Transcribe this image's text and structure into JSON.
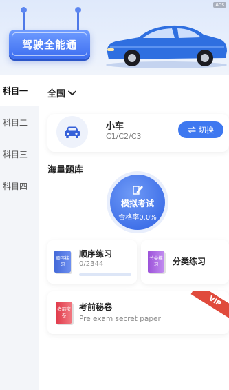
{
  "banner": {
    "ad_tag": "Ads",
    "sign_text": "驾驶全能通"
  },
  "sidebar": {
    "items": [
      {
        "label": "科目一",
        "active": true
      },
      {
        "label": "科目二",
        "active": false
      },
      {
        "label": "科目三",
        "active": false
      },
      {
        "label": "科目四",
        "active": false
      }
    ]
  },
  "region": {
    "label": "全国"
  },
  "vehicle": {
    "title": "小车",
    "subtitle": "C1/C2/C3",
    "switch_label": "切换"
  },
  "question_bank": {
    "title": "海量题库",
    "mock_exam": {
      "label": "模拟考试",
      "pass_rate": "合格率0.0%"
    },
    "sequential": {
      "cover": "顺序练习",
      "title": "顺序练习",
      "progress": "0/2344",
      "progress_value": 0
    },
    "category": {
      "cover": "分类练习",
      "title": "分类练习"
    },
    "pre_exam": {
      "cover": "考前密卷",
      "title": "考前秘卷",
      "subtitle": "Pre exam secret paper",
      "badge": "VIP"
    }
  },
  "colors": {
    "accent": "#3e78f0",
    "vip": "#e04a3c"
  }
}
